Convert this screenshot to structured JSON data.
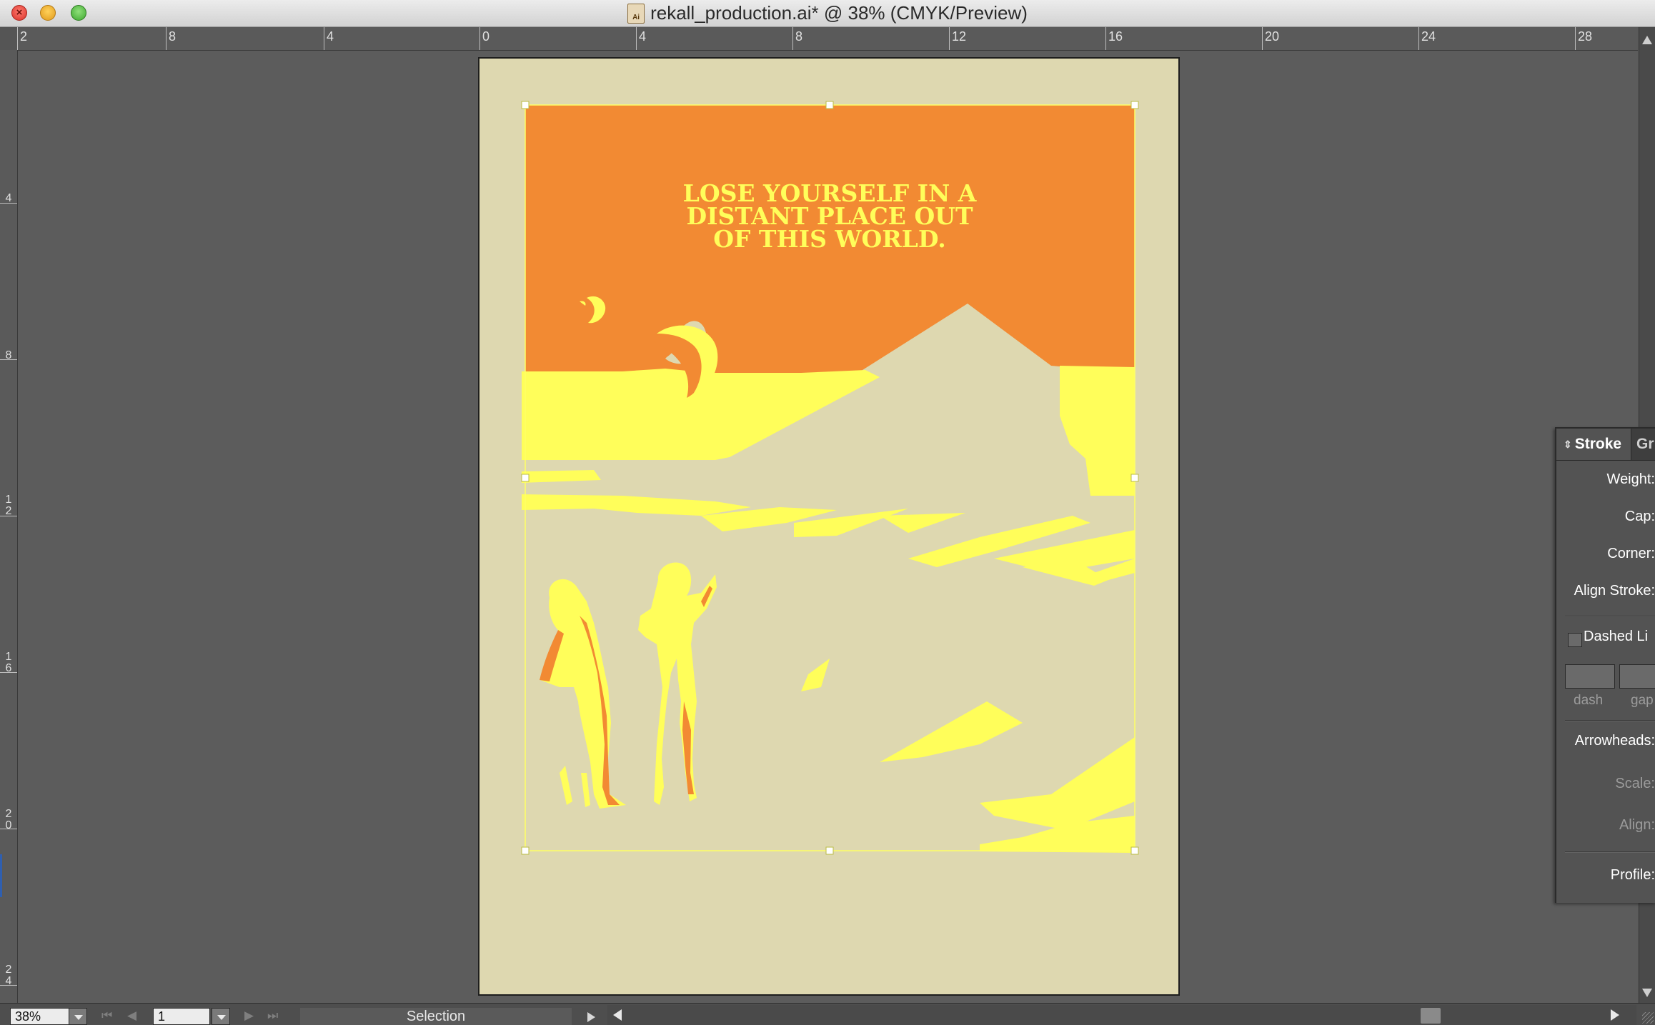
{
  "window": {
    "title": "rekall_production.ai* @ 38% (CMYK/Preview)",
    "file_icon_label": "Ai"
  },
  "rulers": {
    "top_labels": [
      "2",
      "8",
      "4",
      "0",
      "4",
      "8",
      "12",
      "16",
      "20",
      "24",
      "28"
    ],
    "left_labels": [
      "4",
      "8",
      "12",
      "16",
      "20",
      "24"
    ]
  },
  "artboard": {
    "colors": {
      "paper": "#ded8b0",
      "sky": "#f28a33",
      "sand": "#fffe5a",
      "selection": "#ffff66"
    },
    "headline_lines": [
      "LOSE YOURSELF IN A",
      "DISTANT PLACE OUT",
      "OF THIS WORLD."
    ]
  },
  "stroke_panel": {
    "tab_active": "Stroke",
    "tab_inactive": "Gr",
    "weight_label": "Weight:",
    "cap_label": "Cap:",
    "corner_label": "Corner:",
    "align_stroke_label": "Align Stroke:",
    "dashed_line_label": "Dashed Li",
    "dash_label": "dash",
    "gap_label": "gap",
    "arrowheads_label": "Arrowheads:",
    "scale_label": "Scale:",
    "align_label": "Align:",
    "profile_label": "Profile:"
  },
  "status_bar": {
    "zoom_value": "38%",
    "page_value": "1",
    "tool_status": "Selection"
  }
}
